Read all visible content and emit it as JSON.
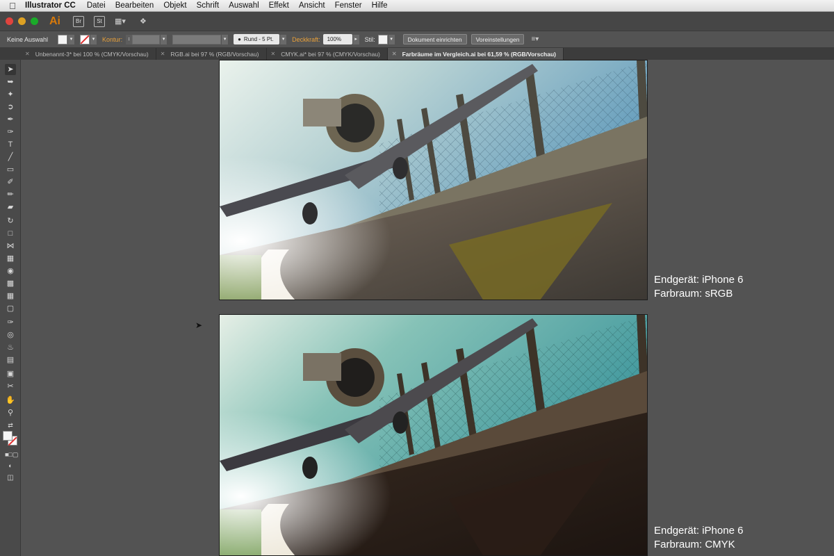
{
  "menubar": {
    "app_name": "Illustrator CC",
    "items": [
      "Datei",
      "Bearbeiten",
      "Objekt",
      "Schrift",
      "Auswahl",
      "Effekt",
      "Ansicht",
      "Fenster",
      "Hilfe"
    ]
  },
  "appbar": {
    "logo": "Ai",
    "bridge": "Br",
    "stock": "St"
  },
  "control": {
    "selection": "Keine Auswahl",
    "stroke_label": "Kontur:",
    "brush": "Rund - 5 Pt.",
    "opacity_label": "Deckkraft:",
    "opacity_value": "100%",
    "style_label": "Stil:",
    "doc_setup_button": "Dokument einrichten",
    "prefs_button": "Voreinstellungen"
  },
  "tabs": [
    {
      "label": "Unbenannt-3* bei 100 % (CMYK/Vorschau)",
      "active": false
    },
    {
      "label": "RGB.ai bei 97 % (RGB/Vorschau)",
      "active": false
    },
    {
      "label": "CMYK.ai* bei 97 % (CMYK/Vorschau)",
      "active": false
    },
    {
      "label": "Farbräume im Vergleich.ai bei 61,59 % (RGB/Vorschau)",
      "active": true
    }
  ],
  "tools": [
    "selection-tool",
    "direct-selection-tool",
    "magic-wand-tool",
    "lasso-tool",
    "pen-tool",
    "curvature-tool",
    "type-tool",
    "line-tool",
    "rectangle-tool",
    "paintbrush-tool",
    "shaper-tool",
    "eraser-tool",
    "rotate-tool",
    "scale-tool",
    "width-tool",
    "free-transform-tool",
    "shape-builder-tool",
    "perspective-grid-tool",
    "mesh-tool",
    "gradient-tool",
    "eyedropper-tool",
    "blend-tool",
    "symbol-sprayer-tool",
    "column-graph-tool",
    "artboard-tool",
    "slice-tool",
    "hand-tool",
    "zoom-tool"
  ],
  "artboards": [
    {
      "caption_line1": "Endgerät: iPhone 6",
      "caption_line2": "Farbraum: sRGB"
    },
    {
      "caption_line1": "Endgerät: iPhone 6",
      "caption_line2": "Farbraum: CMYK"
    }
  ],
  "colors": {
    "workspace": "#535353",
    "accent_orange": "#e8a03a"
  }
}
